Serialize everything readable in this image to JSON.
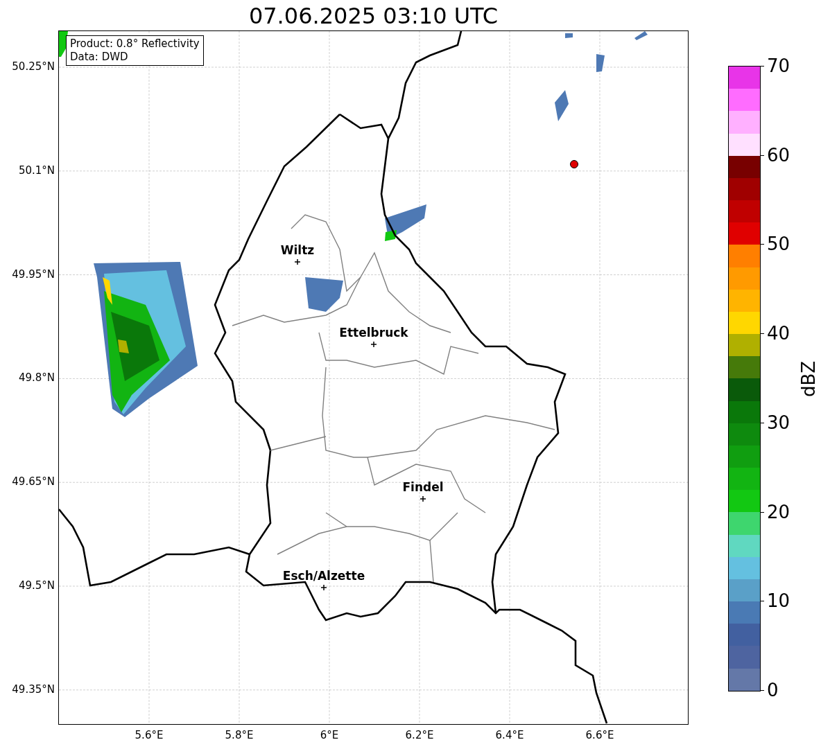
{
  "title": "07.06.2025 03:10 UTC",
  "info_box": [
    "Product: 0.8° Reflectivity",
    "Data: DWD"
  ],
  "y_ticks": [
    "50.25°N",
    "50.1°N",
    "49.95°N",
    "49.8°N",
    "49.65°N",
    "49.5°N",
    "49.35°N"
  ],
  "x_ticks": [
    "5.6°E",
    "5.8°E",
    "6°E",
    "6.2°E",
    "6.4°E",
    "6.6°E"
  ],
  "cities": [
    {
      "name": "Wiltz"
    },
    {
      "name": "Ettelbruck"
    },
    {
      "name": "Findel"
    },
    {
      "name": "Esch/Alzette"
    }
  ],
  "colorbar": {
    "label": "dBZ",
    "ticks": [
      "70",
      "60",
      "50",
      "40",
      "30",
      "20",
      "10",
      "0"
    ],
    "segments": [
      {
        "color": "#6478a8"
      },
      {
        "color": "#4e64a0"
      },
      {
        "color": "#4260a0"
      },
      {
        "color": "#4a7ab4"
      },
      {
        "color": "#5aa0c8"
      },
      {
        "color": "#64c0e0"
      },
      {
        "color": "#60d8c0"
      },
      {
        "color": "#3ed66e"
      },
      {
        "color": "#12c812"
      },
      {
        "color": "#12b412"
      },
      {
        "color": "#109e10"
      },
      {
        "color": "#0e8a0e"
      },
      {
        "color": "#0a780a"
      },
      {
        "color": "#0a5a0a"
      },
      {
        "color": "#467a0a"
      },
      {
        "color": "#b0b000"
      },
      {
        "color": "#ffd700"
      },
      {
        "color": "#ffb400"
      },
      {
        "color": "#ff9a00"
      },
      {
        "color": "#ff7f00"
      },
      {
        "color": "#e00000"
      },
      {
        "color": "#c00000"
      },
      {
        "color": "#a00000"
      },
      {
        "color": "#780000"
      },
      {
        "color": "#ffe0ff"
      },
      {
        "color": "#ffb0ff"
      },
      {
        "color": "#ff6cff"
      },
      {
        "color": "#e834e8"
      }
    ]
  }
}
